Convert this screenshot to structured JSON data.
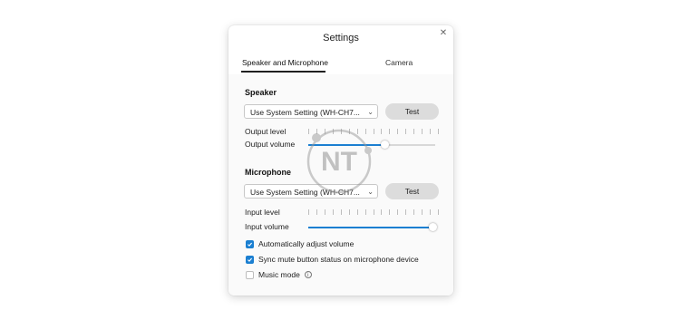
{
  "dialog": {
    "title": "Settings",
    "tabs": [
      {
        "label": "Speaker and Microphone",
        "active": true
      },
      {
        "label": "Camera",
        "active": false
      }
    ]
  },
  "speaker": {
    "section_title": "Speaker",
    "device_value": "Use System Setting (WH-CH7...",
    "test_label": "Test",
    "output_level_label": "Output level",
    "output_volume_label": "Output volume",
    "output_volume": 0.6
  },
  "microphone": {
    "section_title": "Microphone",
    "device_value": "Use System Setting (WH-CH7...",
    "test_label": "Test",
    "input_level_label": "Input level",
    "input_volume_label": "Input volume",
    "input_volume": 0.98
  },
  "options": [
    {
      "label": "Automatically adjust volume",
      "checked": true
    },
    {
      "label": "Sync mute button status on microphone device",
      "checked": true
    },
    {
      "label": "Music mode",
      "checked": false
    }
  ],
  "watermark": {
    "text": "NT"
  },
  "colors": {
    "accent": "#1b7fd1",
    "button_bg": "#dcdcdc"
  },
  "icons": {
    "close": "close-icon",
    "chevron": "chevron-down-icon",
    "info": "info-icon",
    "check": "checkmark-icon"
  }
}
